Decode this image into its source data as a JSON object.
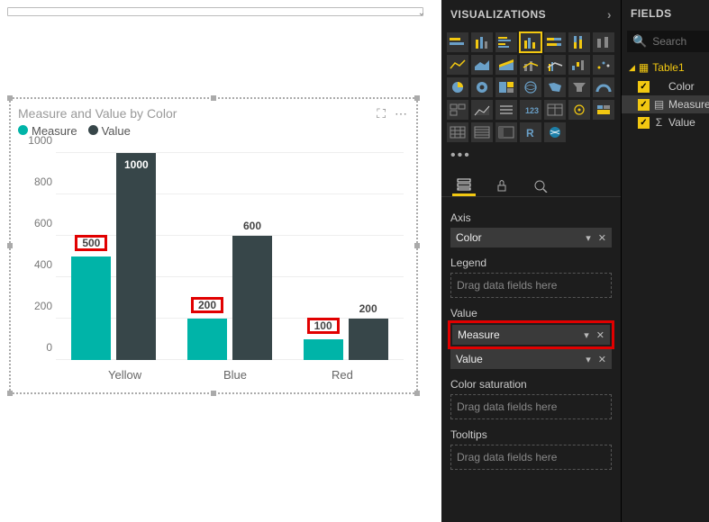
{
  "viz_panel": {
    "title": "VISUALIZATIONS"
  },
  "fields_panel": {
    "title": "FIELDS",
    "search_placeholder": "Search",
    "table": "Table1"
  },
  "fields": [
    {
      "name": "Color",
      "icon": ""
    },
    {
      "name": "Measure",
      "icon": "calc"
    },
    {
      "name": "Value",
      "icon": "sigma"
    }
  ],
  "wells": {
    "axis_label": "Axis",
    "axis_items": [
      "Color"
    ],
    "legend_label": "Legend",
    "legend_placeholder": "Drag data fields here",
    "value_label": "Value",
    "value_items": [
      "Measure",
      "Value"
    ],
    "colorsat_label": "Color saturation",
    "colorsat_placeholder": "Drag data fields here",
    "tooltips_label": "Tooltips",
    "tooltips_placeholder": "Drag data fields here"
  },
  "chart": {
    "title": "Measure and Value by Color",
    "legend": [
      {
        "name": "Measure",
        "color": "#00b4a8"
      },
      {
        "name": "Value",
        "color": "#374649"
      }
    ]
  },
  "chart_data": {
    "type": "bar",
    "title": "Measure and Value by Color",
    "categories": [
      "Yellow",
      "Blue",
      "Red"
    ],
    "series": [
      {
        "name": "Measure",
        "values": [
          500,
          200,
          100
        ]
      },
      {
        "name": "Value",
        "values": [
          1000,
          600,
          200
        ]
      }
    ],
    "ylim": [
      0,
      1000
    ],
    "yticks": [
      0,
      200,
      400,
      600,
      800,
      1000
    ],
    "xlabel": "",
    "ylabel": ""
  }
}
